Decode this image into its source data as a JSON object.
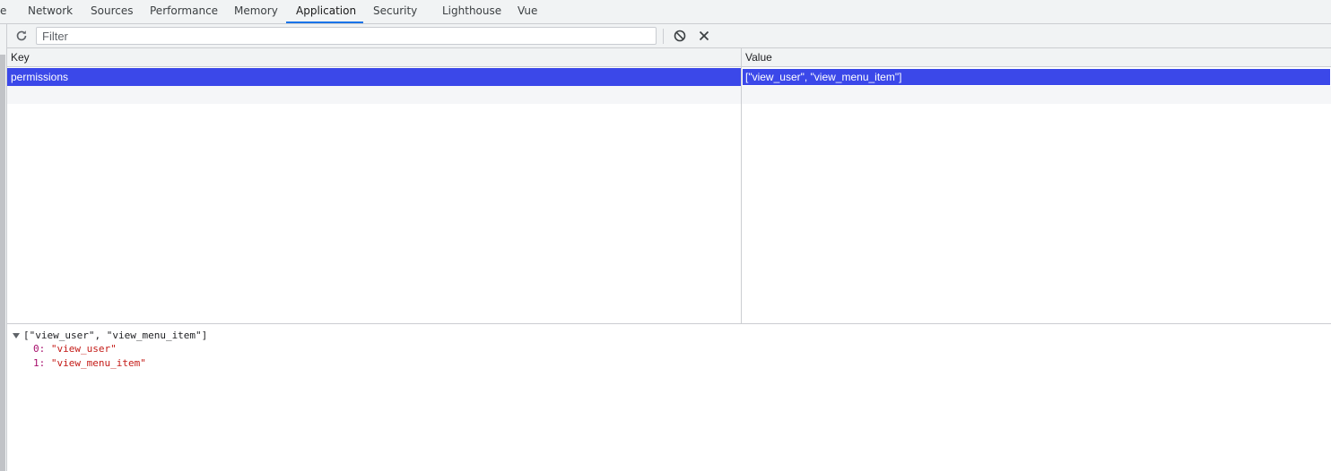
{
  "tabs": [
    "e",
    "Network",
    "Sources",
    "Performance",
    "Memory",
    "Application",
    "Security",
    "Lighthouse",
    "Vue"
  ],
  "active_tab": "Application",
  "toolbar": {
    "filter_placeholder": "Filter",
    "refresh_icon": "refresh-icon",
    "clear_icon": "block-icon",
    "delete_icon": "close-icon"
  },
  "table": {
    "columns": [
      "Key",
      "Value"
    ],
    "rows": [
      {
        "key": "permissions",
        "value": "[\"view_user\", \"view_menu_item\"]",
        "selected": true
      }
    ]
  },
  "preview": {
    "summary": "[\"view_user\", \"view_menu_item\"]",
    "items": [
      {
        "index": "0",
        "value": "\"view_user\""
      },
      {
        "index": "1",
        "value": "\"view_menu_item\""
      }
    ]
  },
  "colors": {
    "selection": "#3b48e9",
    "accent": "#1a73e8",
    "property_key": "#a70d6b",
    "string_value": "#c41a16"
  }
}
